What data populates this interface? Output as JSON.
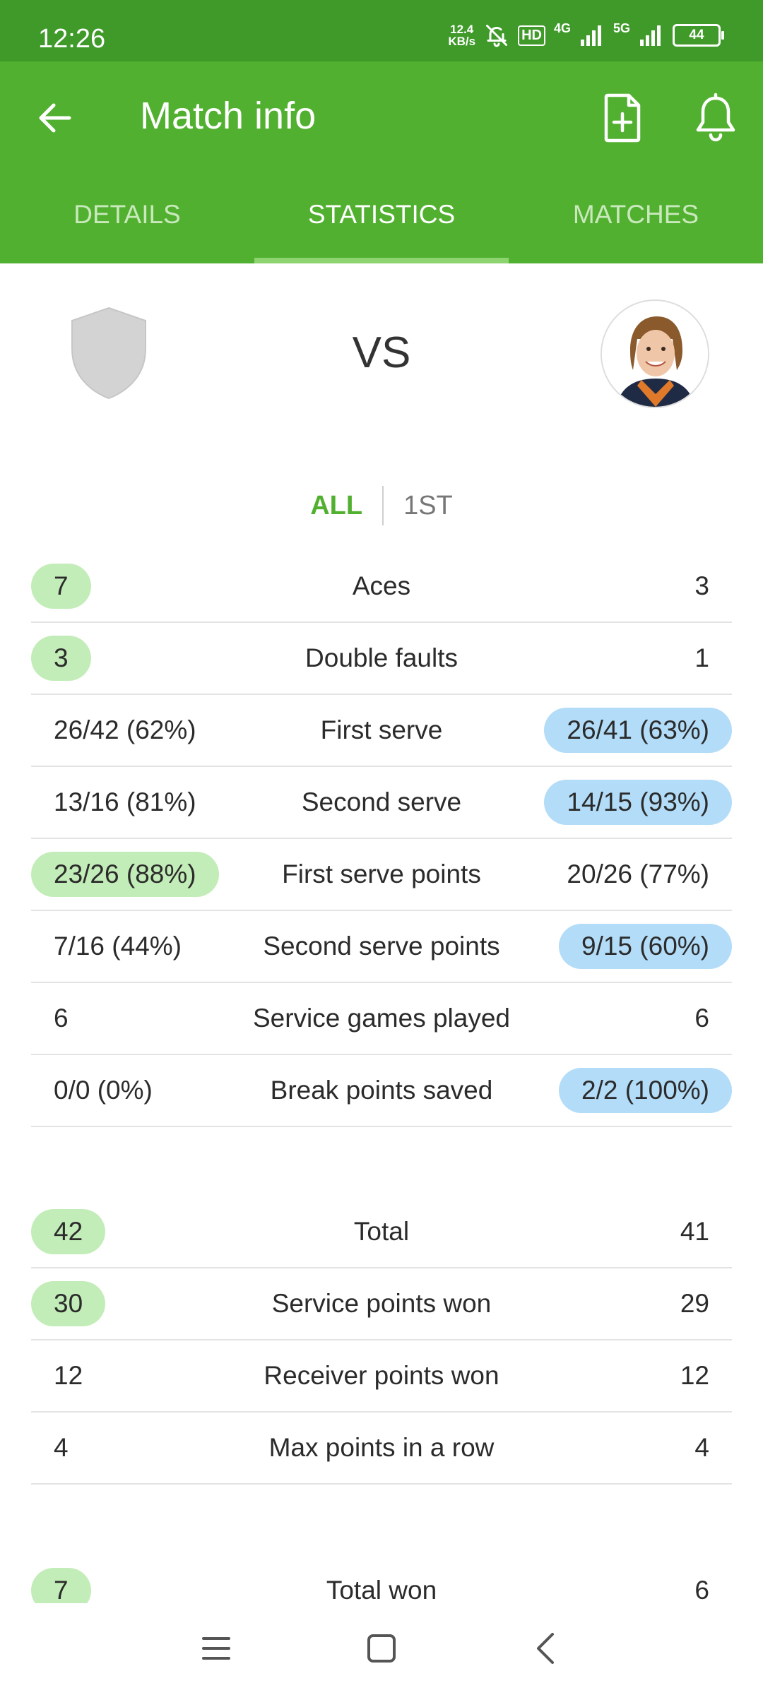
{
  "status_bar": {
    "time": "12:26",
    "net_speed_value": "12.4",
    "net_speed_unit": "KB/s",
    "hd_label": "HD",
    "net_4g": "4G",
    "net_5g": "5G",
    "battery": "44"
  },
  "app_bar": {
    "title": "Match info",
    "tabs": [
      {
        "label": "DETAILS"
      },
      {
        "label": "STATISTICS"
      },
      {
        "label": "MATCHES"
      }
    ]
  },
  "header": {
    "vs": "VS"
  },
  "periods": [
    {
      "label": "ALL"
    },
    {
      "label": "1ST"
    }
  ],
  "stats_sections": [
    [
      {
        "label": "Aces",
        "left": "7",
        "right": "3"
      },
      {
        "label": "Double faults",
        "left": "3",
        "right": "1"
      },
      {
        "label": "First serve",
        "left": "26/42 (62%)",
        "right": "26/41 (63%)"
      },
      {
        "label": "Second serve",
        "left": "13/16 (81%)",
        "right": "14/15 (93%)"
      },
      {
        "label": "First serve points",
        "left": "23/26 (88%)",
        "right": "20/26 (77%)"
      },
      {
        "label": "Second serve points",
        "left": "7/16 (44%)",
        "right": "9/15 (60%)"
      },
      {
        "label": "Service games played",
        "left": "6",
        "right": "6"
      },
      {
        "label": "Break points saved",
        "left": "0/0 (0%)",
        "right": "2/2 (100%)"
      }
    ],
    [
      {
        "label": "Total",
        "left": "42",
        "right": "41"
      },
      {
        "label": "Service points won",
        "left": "30",
        "right": "29"
      },
      {
        "label": "Receiver points won",
        "left": "12",
        "right": "12"
      },
      {
        "label": "Max points in a row",
        "left": "4",
        "right": "4"
      }
    ],
    [
      {
        "label": "Total won",
        "left": "7",
        "right": "6"
      }
    ]
  ],
  "colors": {
    "status_bar": "#3f9a2a",
    "app_bar": "#52b030",
    "left_highlight": "#c3edb8",
    "right_highlight": "#b3dcf8"
  },
  "icons": {
    "back": "arrow-left-icon",
    "doc": "document-add-icon",
    "bell": "bell-icon",
    "menu": "menu-icon",
    "home": "home-square-icon",
    "nav_back": "chevron-left-icon"
  }
}
